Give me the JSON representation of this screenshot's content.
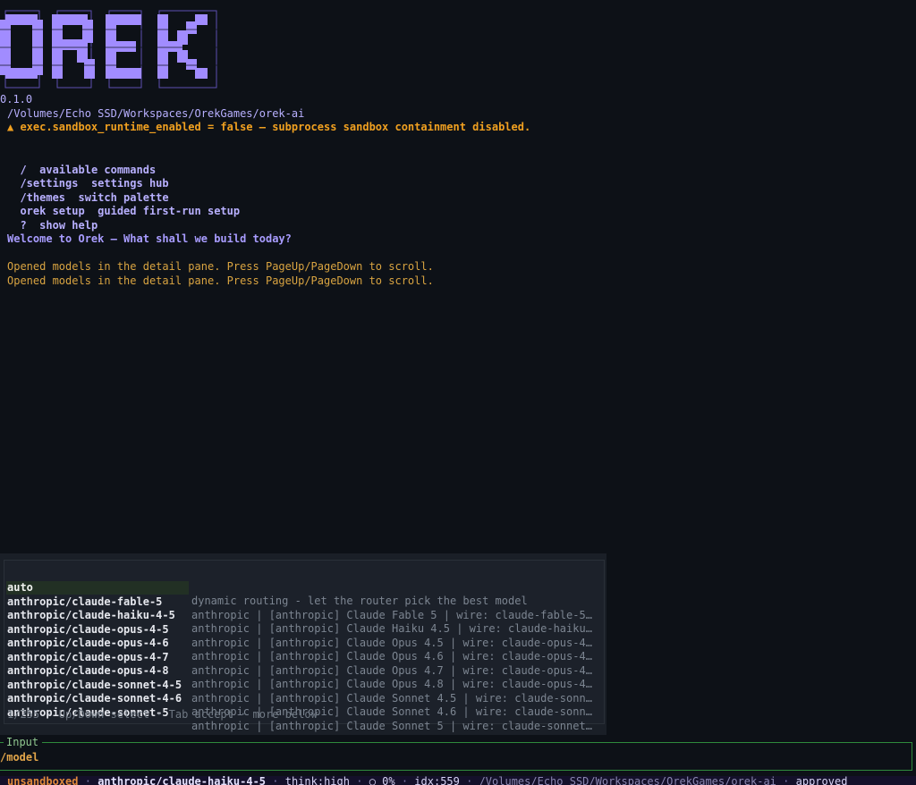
{
  "header": {
    "version": "0.1.0",
    "cwd": "/Volumes/Echo SSD/Workspaces/OrekGames/orek-ai",
    "warning": "▲ exec.sandbox_runtime_enabled = false — subprocess sandbox containment disabled."
  },
  "help": [
    {
      "cmd": "/",
      "desc": "available commands"
    },
    {
      "cmd": "/settings",
      "desc": "settings hub"
    },
    {
      "cmd": "/themes",
      "desc": "switch palette"
    },
    {
      "cmd": "orek setup",
      "desc": "guided first-run setup"
    },
    {
      "cmd": "?",
      "desc": "show help"
    }
  ],
  "welcome": "Welcome to Orek — What shall we build today?",
  "messages": [
    "Opened models in the detail pane. Press PageUp/PageDown to scroll.",
    "Opened models in the detail pane. Press PageUp/PageDown to scroll."
  ],
  "completion": {
    "items": [
      {
        "name": "auto",
        "desc": "dynamic routing - let the router pick the best model"
      },
      {
        "name": "anthropic/claude-fable-5",
        "desc": "anthropic | [anthropic] Claude Fable 5 | wire: claude-fable-5…"
      },
      {
        "name": "anthropic/claude-haiku-4-5",
        "desc": "anthropic | [anthropic] Claude Haiku 4.5 | wire: claude-haiku…"
      },
      {
        "name": "anthropic/claude-opus-4-5",
        "desc": "anthropic | [anthropic] Claude Opus 4.5 | wire: claude-opus-4…"
      },
      {
        "name": "anthropic/claude-opus-4-6",
        "desc": "anthropic | [anthropic] Claude Opus 4.6 | wire: claude-opus-4…"
      },
      {
        "name": "anthropic/claude-opus-4-7",
        "desc": "anthropic | [anthropic] Claude Opus 4.7 | wire: claude-opus-4…"
      },
      {
        "name": "anthropic/claude-opus-4-8",
        "desc": "anthropic | [anthropic] Claude Opus 4.8 | wire: claude-opus-4…"
      },
      {
        "name": "anthropic/claude-sonnet-4-5",
        "desc": "anthropic | [anthropic] Claude Sonnet 4.5 | wire: claude-sonn…"
      },
      {
        "name": "anthropic/claude-sonnet-4-6",
        "desc": "anthropic | [anthropic] Claude Sonnet 4.6 | wire: claude-sonn…"
      },
      {
        "name": "anthropic/claude-sonnet-5",
        "desc": "anthropic | [anthropic] Claude Sonnet 5 | wire: claude-sonnet…"
      }
    ],
    "footer": "1/255 · Up/Down select · Tab accept · more below"
  },
  "input": {
    "label": "Input",
    "value": "/model"
  },
  "statusbar": {
    "sandbox": "unsandboxed",
    "model": "anthropic/claude-haiku-4-5",
    "think": "think:high",
    "context": "○ 0%",
    "idx": "idx:559",
    "path": "/Volumes/Echo SSD/Workspaces/OrekGames/orek-ai",
    "approval": "approved",
    "separator": "·"
  },
  "colors": {
    "background": "#0d1117",
    "logo": "#a18cff",
    "accent": "#b8b0ff",
    "warning": "#f0a020",
    "message": "#d9a441",
    "input_border": "#2f8a3c",
    "input_value": "#e3a64a",
    "selected_row": "#223024"
  }
}
